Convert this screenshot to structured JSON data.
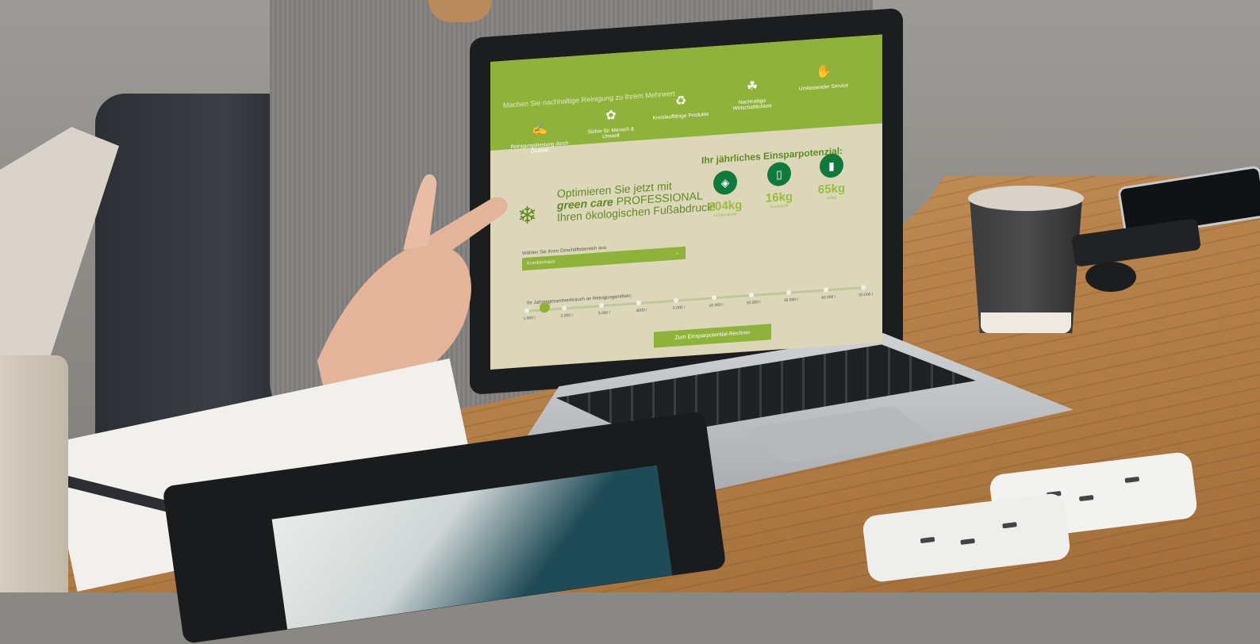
{
  "website": {
    "band_heading": "Machen Sie nachhaltige Reinigung zu Ihrem Mehrwert",
    "features": [
      {
        "icon": "cleaning-quality-icon",
        "label": "Reinigungsleistung durch Qualität"
      },
      {
        "icon": "hands-leaf-icon",
        "label": "Sicher für Mensch & Umwelt"
      },
      {
        "icon": "recycle-leaves-icon",
        "label": "Kreislauffähige Produkte"
      },
      {
        "icon": "plant-growth-icon",
        "label": "Nachhaltige Wirtschaftlichkeit"
      },
      {
        "icon": "handshake-icon",
        "label": "Umfassender Service"
      }
    ],
    "headline_line1": "Optimieren Sie jetzt mit",
    "brand": "green care",
    "brand_suffix": "PROFESSIONAL",
    "headline_line3": "Ihren ökologischen Fußabdruck!",
    "savings_title": "Ihr jährliches Einsparpotenzial:",
    "stats": [
      {
        "icon": "co2-icon",
        "value": "204kg",
        "label": "Kohlendioxid"
      },
      {
        "icon": "bottle-icon",
        "value": "16kg",
        "label": "Kunststoff"
      },
      {
        "icon": "phone-icon",
        "value": "65kg",
        "label": "Abfall"
      }
    ],
    "select_label": "Wählen Sie Ihren Geschäftsbereich aus:",
    "select_value": "Krankenhaus",
    "slider_label": "Ihr Jahresgesamtverbrauch an Reinigungsmitteln:",
    "slider_ticks": [
      "1.000 l",
      "2.000 l",
      "3.000 l",
      "4000 l",
      "5.000 l",
      "10.000 l",
      "20.000 l",
      "30.000 l",
      "40.000 l",
      "50.000 l"
    ],
    "slider_value_index": 0,
    "cta_label": "Zum Einsparpotential-Rechner"
  },
  "colors": {
    "accent_green": "#8fb23b",
    "dark_green": "#0f7a3b",
    "screen_bg": "#ddd7b9"
  }
}
